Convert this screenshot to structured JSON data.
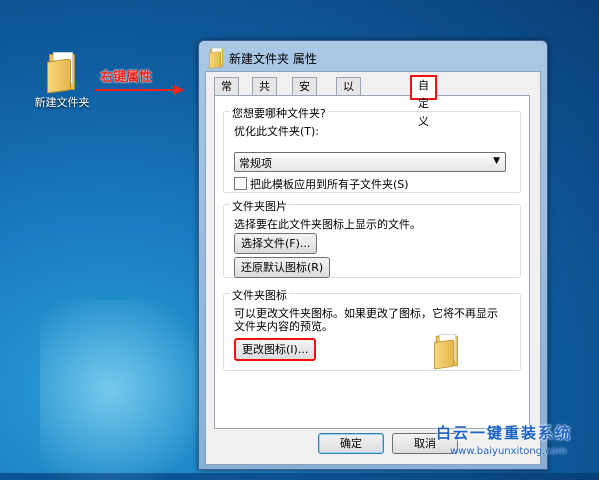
{
  "desktop": {
    "folder_label": "新建文件夹",
    "annotation_text": "右键属性",
    "annotation_color": "#e8241c"
  },
  "window": {
    "title": "新建文件夹 属性",
    "folder_icon": "folder-icon"
  },
  "tabs": [
    {
      "label": "常规"
    },
    {
      "label": "共享"
    },
    {
      "label": "安全"
    },
    {
      "label": "以前的版本"
    },
    {
      "label": "自定义",
      "active": true
    }
  ],
  "customize": {
    "optimize_group": {
      "title": "您想要哪种文件夹?",
      "optimize_label": "优化此文件夹(T):",
      "select_value": "常规项",
      "apply_subfolders_label": "把此模板应用到所有子文件夹(S)",
      "apply_subfolders_checked": false
    },
    "picture_group": {
      "title": "文件夹图片",
      "description": "选择要在此文件夹图标上显示的文件。",
      "choose_file_button": "选择文件(F)...",
      "restore_default_button": "还原默认图标(R)"
    },
    "icon_group": {
      "title": "文件夹图标",
      "description_line1": "可以更改文件夹图标。如果更改了图标，它将不再显示",
      "description_line2": "文件夹内容的预览。",
      "change_icon_button": "更改图标(I)..."
    }
  },
  "buttons": {
    "ok": "确定",
    "cancel": "取消"
  },
  "watermark": {
    "text": "白云一键重装系统",
    "url": "www.baiyunxitong.com"
  },
  "colors": {
    "highlight_box": "#ee1111",
    "window_frame": "#88afd8",
    "watermark": "#1b63c4"
  }
}
